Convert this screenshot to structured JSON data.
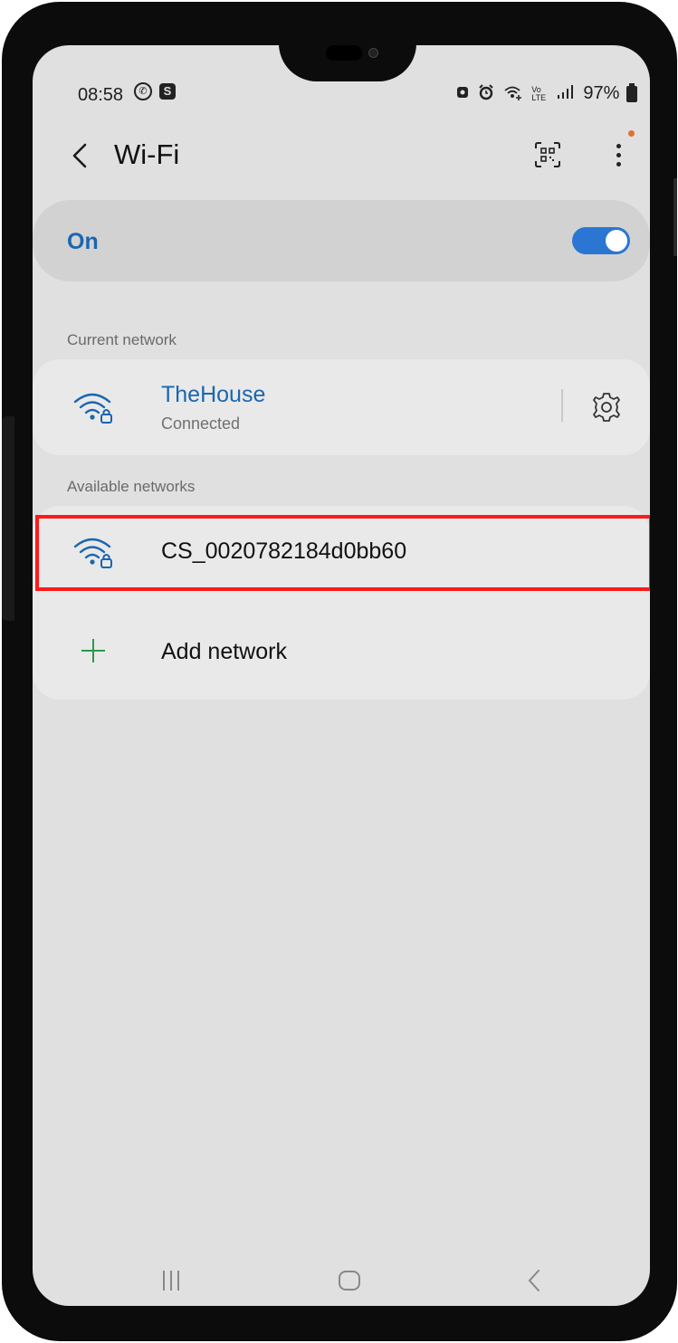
{
  "status_bar": {
    "time": "08:58",
    "left_icons": [
      "whatsapp-icon",
      "s-app-icon"
    ],
    "right_icons": [
      "lock-icon",
      "alarm-icon",
      "wifi-plus-icon",
      "volte-icon",
      "signal-icon",
      "battery-icon"
    ],
    "volte_text": "Vo LTE",
    "battery": "97%"
  },
  "header": {
    "title": "Wi-Fi",
    "back_icon": "chevron-left-icon",
    "qr_icon": "qr-scan-icon",
    "more_icon": "more-vertical-icon"
  },
  "wifi_toggle": {
    "label": "On",
    "state": true,
    "accent": "#2a76d2"
  },
  "current_network": {
    "section_label": "Current network",
    "name": "TheHouse",
    "status": "Connected",
    "settings_icon": "gear-icon"
  },
  "available_networks": {
    "section_label": "Available networks",
    "items": [
      {
        "name": "CS_0020782184d0bb60",
        "icon": "wifi-lock-icon",
        "highlighted": true
      }
    ],
    "add_network_label": "Add network"
  },
  "nav_bar": {
    "recent_icon": "recent-apps-icon",
    "home_icon": "home-icon",
    "back_icon": "back-icon"
  },
  "colors": {
    "highlight_border": "#ff1a1a",
    "link_blue": "#1a66b0",
    "add_green": "#2a9a4a"
  }
}
